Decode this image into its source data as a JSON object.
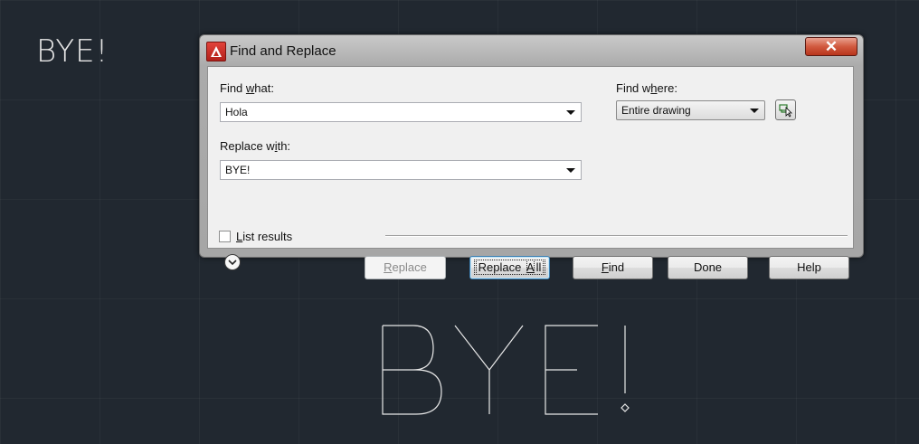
{
  "canvas": {
    "small_text": "BYE!",
    "big_text": "BYE!"
  },
  "dialog": {
    "title": "Find and Replace",
    "close_label": "✕",
    "find_what": {
      "prefix": "Find ",
      "access": "w",
      "suffix": "hat:",
      "value": "Hola"
    },
    "replace_with": {
      "prefix": "Replace w",
      "access": "i",
      "suffix": "th:",
      "value": "BYE!"
    },
    "find_where": {
      "prefix": "Find w",
      "access": "h",
      "suffix": "ere:",
      "value": "Entire drawing"
    },
    "list_results": {
      "access": "L",
      "suffix": "ist results",
      "checked": false
    },
    "buttons": {
      "replace": {
        "access": "R",
        "suffix": "eplace",
        "enabled": false
      },
      "replace_all": {
        "prefix": "Replace ",
        "access": "A",
        "suffix": "ll"
      },
      "find": {
        "access": "F",
        "suffix": "ind"
      },
      "done": "Done",
      "help": "Help"
    }
  },
  "icons": [
    "app-icon",
    "close-icon",
    "select-objects-icon",
    "expand-chevron-icon"
  ]
}
